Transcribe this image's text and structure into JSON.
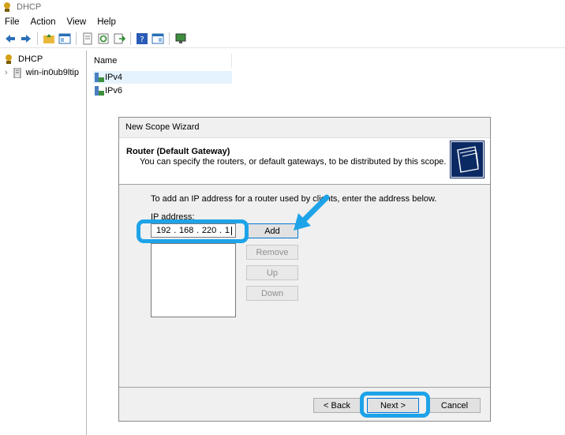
{
  "window": {
    "title": "DHCP"
  },
  "menu": [
    "File",
    "Action",
    "View",
    "Help"
  ],
  "tree": {
    "root": "DHCP",
    "server": "win-in0ub9ltip"
  },
  "list": {
    "column_name": "Name",
    "items": [
      "IPv4",
      "IPv6"
    ]
  },
  "wizard": {
    "title": "New Scope Wizard",
    "heading": "Router (Default Gateway)",
    "subheading": "You can specify the routers, or default gateways, to be distributed by this scope.",
    "instruction": "To add an IP address for a router used by clients, enter the address below.",
    "ip_label": "IP address:",
    "ip_octets": [
      "192",
      "168",
      "220",
      "1"
    ],
    "buttons": {
      "add": "Add",
      "remove": "Remove",
      "up": "Up",
      "down": "Down"
    },
    "footer": {
      "back": "< Back",
      "next": "Next >",
      "cancel": "Cancel"
    }
  },
  "colors": {
    "highlight": "#1ea3e8",
    "logo_bg": "#0b2a64"
  }
}
